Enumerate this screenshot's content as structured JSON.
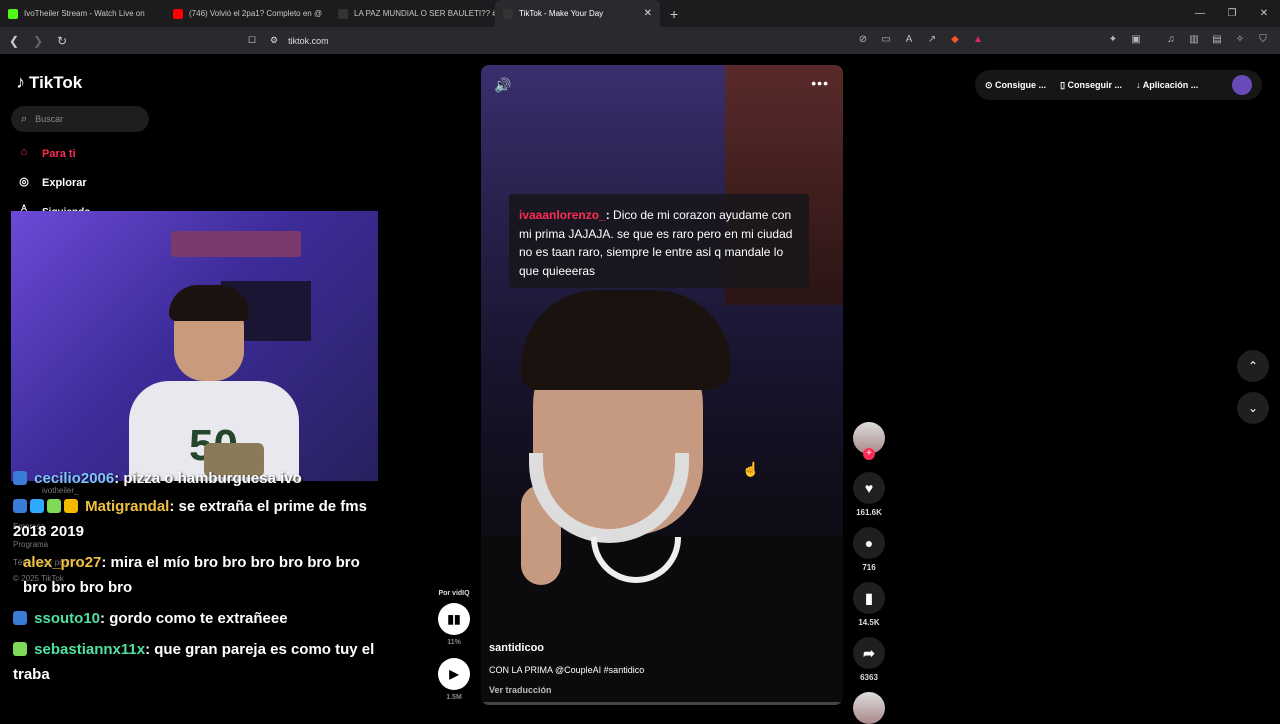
{
  "browser": {
    "tabs": [
      {
        "label": "IvoTheiler Stream - Watch Live on",
        "color": "#53fc18"
      },
      {
        "label": "(746) Volvió el 2pa1? Completo en @",
        "color": "#ff0000"
      },
      {
        "label": "LA PAZ MUNDIAL O SER BAULETI?? #",
        "color": "#ffffff"
      },
      {
        "label": "TikTok - Make Your Day",
        "color": "#ffffff",
        "active": true
      }
    ],
    "new_tab": "+",
    "url": "tiktok.com",
    "window_controls": [
      "—",
      "❐",
      "✕"
    ]
  },
  "sidebar": {
    "logo": "TikTok",
    "search_placeholder": "Buscar",
    "nav": [
      {
        "label": "Para ti",
        "icon": "home-icon",
        "active": true
      },
      {
        "label": "Explorar",
        "icon": "compass-icon"
      },
      {
        "label": "Siguiendo",
        "icon": "following-icon"
      }
    ],
    "footer": {
      "user": "ivotheiler_",
      "links": [
        "Empresa",
        "Programa",
        "Términos y políticas"
      ],
      "copyright": "© 2025 TikTok"
    }
  },
  "chat": [
    {
      "user": "cecilio2006",
      "text": ": pizza o hamburguesa ivo",
      "color": "#7fc3ff"
    },
    {
      "user": "Matigrandal",
      "text": ": se extraña el prime de fms 2018 2019",
      "color": "#f0c040"
    },
    {
      "user": "alex_pro27",
      "text": ": mira el mío bro bro bro bro bro bro bro bro bro bro",
      "color": "#f0c040"
    },
    {
      "user": "ssouto10",
      "text": ": gordo como te extrañeee",
      "color": "#50e0a0"
    },
    {
      "user": "sebastiannx11x",
      "text": ": que gran pareja es como tuy el traba",
      "color": "#50e0a0"
    }
  ],
  "video": {
    "caption_user": "ivaaanlorenzo_",
    "caption_text": "Dico de mi corazon ayudame con mi prima JAJAJA. se que es raro pero en mi ciudad no es taan raro, siempre le entre asi q mandale lo que quieeeras",
    "author": "santidicoo",
    "description": "CON LA PRIMA @CoupleAI #santidico",
    "translate": "Ver traducción",
    "sound_icon": "speaker-icon",
    "more": "•••"
  },
  "actions": {
    "likes": "161.6K",
    "comments": "716",
    "saves": "14.5K",
    "shares": "6363"
  },
  "vidiq": {
    "label": "Por vidIQ",
    "percent": "11%",
    "views": "1.5M"
  },
  "topright": {
    "items": [
      "Consigue ...",
      "Conseguir ...",
      "Aplicación ..."
    ]
  },
  "colors": {
    "accent": "#fe2c55"
  }
}
